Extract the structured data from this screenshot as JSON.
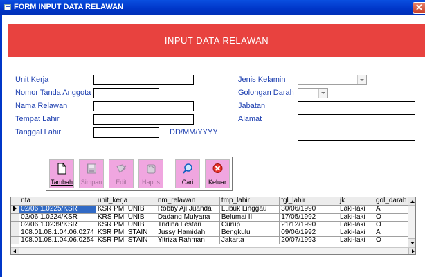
{
  "window": {
    "title": "FORM INPUT DATA RELAWAN",
    "close_glyph": "✕"
  },
  "header": {
    "title": "INPUT DATA RELAWAN",
    "color": "#e8423f"
  },
  "form": {
    "unit_kerja": {
      "label": "Unit Kerja",
      "value": ""
    },
    "nomor_tanda_anggota": {
      "label": "Nomor Tanda Anggota",
      "value": ""
    },
    "nama_relawan": {
      "label": "Nama Relawan",
      "value": ""
    },
    "tempat_lahir": {
      "label": "Tempat Lahir",
      "value": ""
    },
    "tanggal_lahir": {
      "label": "Tanggal Lahir",
      "value": "",
      "hint": "DD/MM/YYYY"
    },
    "jenis_kelamin": {
      "label": "Jenis Kelamin",
      "value": ""
    },
    "golongan_darah": {
      "label": "Golongan Darah",
      "value": ""
    },
    "jabatan": {
      "label": "Jabatan",
      "value": ""
    },
    "alamat": {
      "label": "Alamat",
      "value": ""
    }
  },
  "toolbar": {
    "tambah": "Tambah",
    "simpan": "Simpan",
    "edit": "Edit",
    "hapus": "Hapus",
    "cari": "Cari",
    "keluar": "Keluar"
  },
  "grid": {
    "columns": [
      "nta",
      "unit_kerja",
      "nm_relawan",
      "tmp_lahir",
      "tgl_lahir",
      "jk",
      "gol_darah"
    ],
    "rows": [
      [
        "02/06.1.0225/KSR",
        "KSR PMI UNIB",
        "Robby Aji Juanda",
        "Lubuk Linggau",
        "30/06/1990",
        "Laki-laki",
        "A"
      ],
      [
        "02/06.1.0224/KSR",
        "KRS PMI UNIB",
        "Dadang Mulyana",
        "Belumai II",
        "17/05/1992",
        "Laki-laki",
        "O"
      ],
      [
        "02/06.1.0239/KSR",
        "KSR PMI UNIB",
        "Tridina Lestari",
        "Curup",
        "21/12/1990",
        "Laki-laki",
        "O"
      ],
      [
        "108.01.08.1.04.06.0274",
        "KSR PMI STAIN",
        "Jussy Hamidah",
        "Bengkulu",
        "09/06/1992",
        "Laki-laki",
        "A"
      ],
      [
        "108.01.08.1.04.06.0254",
        "KSR PMI STAIN",
        "Yitriza Rahman",
        "Jakarta",
        "20/07/1993",
        "Laki-laki",
        "O"
      ]
    ]
  }
}
